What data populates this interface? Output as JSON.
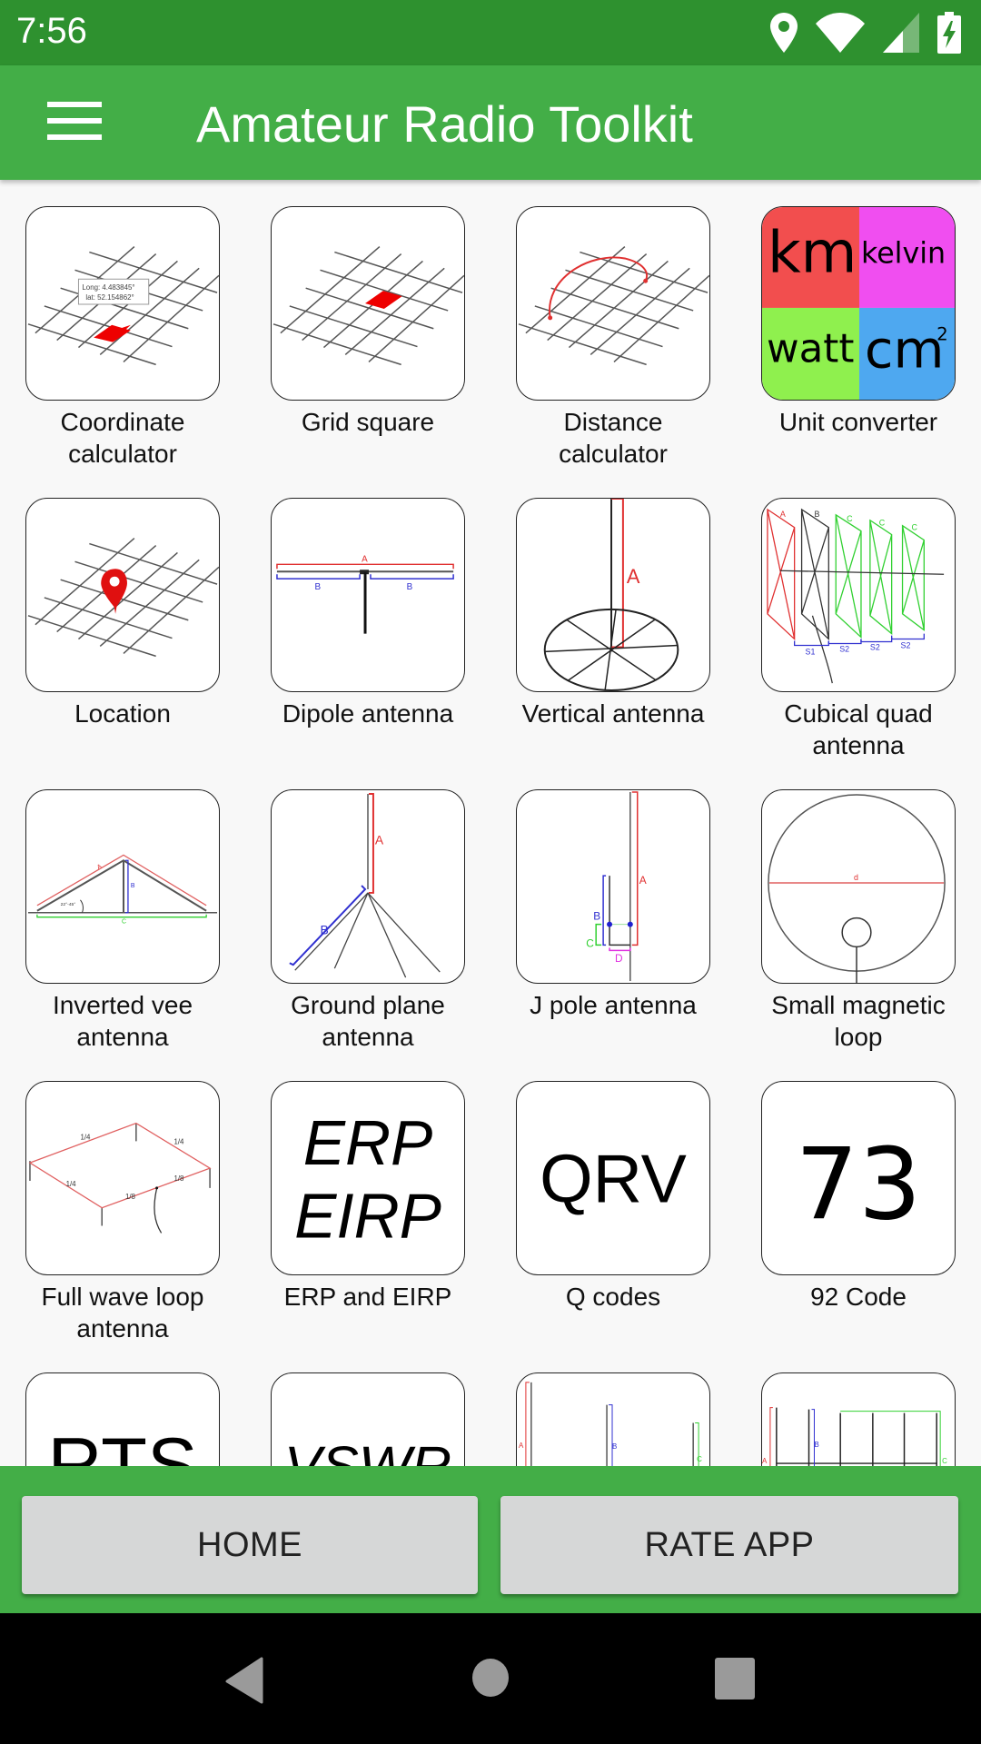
{
  "status_bar": {
    "time": "7:56",
    "icons": [
      "location-icon",
      "wifi-icon",
      "cell-signal-icon",
      "battery-charging-icon"
    ]
  },
  "app_bar": {
    "menu_icon": "hamburger-menu-icon",
    "title": "Amateur Radio Toolkit"
  },
  "tools": [
    {
      "label": "Coordinate calculator",
      "icon": "coordinate-grid-icon",
      "icon_text": [
        "Long:   4.483845°",
        "lat:  52.154862°"
      ]
    },
    {
      "label": "Grid square",
      "icon": "grid-square-icon"
    },
    {
      "label": "Distance calculator",
      "icon": "distance-arc-icon"
    },
    {
      "label": "Unit converter",
      "icon": "unit-converter-icon",
      "icon_text": [
        "km",
        "kelvin",
        "watt",
        "cm",
        "2"
      ]
    },
    {
      "label": "Location",
      "icon": "location-pin-icon"
    },
    {
      "label": "Dipole antenna",
      "icon": "dipole-antenna-icon",
      "icon_text": [
        "A",
        "B",
        "B"
      ]
    },
    {
      "label": "Vertical antenna",
      "icon": "vertical-antenna-icon",
      "icon_text": [
        "A"
      ]
    },
    {
      "label": "Cubical quad antenna",
      "icon": "cubical-quad-icon",
      "icon_text": [
        "A",
        "B",
        "C",
        "C",
        "C",
        "S1",
        "S2",
        "S2",
        "S2"
      ]
    },
    {
      "label": "Inverted vee antenna",
      "icon": "inverted-vee-icon",
      "icon_text": [
        "A",
        "B",
        "C",
        "22°-45°"
      ]
    },
    {
      "label": "Ground plane antenna",
      "icon": "ground-plane-icon",
      "icon_text": [
        "A",
        "B"
      ]
    },
    {
      "label": "J pole antenna",
      "icon": "j-pole-icon",
      "icon_text": [
        "A",
        "B",
        "C",
        "D"
      ]
    },
    {
      "label": "Small magnetic loop",
      "icon": "magnetic-loop-icon",
      "icon_text": [
        "d"
      ]
    },
    {
      "label": "Full wave loop antenna",
      "icon": "full-wave-loop-icon",
      "icon_text": [
        "1/4",
        "1/4",
        "1/4",
        "1/8",
        "1/8"
      ]
    },
    {
      "label": "ERP and EIRP",
      "icon": "erp-eirp-icon",
      "icon_text": [
        "ERP",
        "EIRP"
      ]
    },
    {
      "label": "Q codes",
      "icon": "q-codes-icon",
      "icon_text": [
        "QRV"
      ]
    },
    {
      "label": "92 Code",
      "icon": "code-73-icon",
      "icon_text": [
        "73"
      ]
    },
    {
      "label": "",
      "icon": "rts-icon",
      "icon_text": [
        "RTS"
      ]
    },
    {
      "label": "",
      "icon": "vswr-icon",
      "icon_text": [
        "VSWR"
      ]
    },
    {
      "label": "",
      "icon": "yagi-elements-icon",
      "icon_text": [
        "A",
        "B",
        "C"
      ]
    },
    {
      "label": "",
      "icon": "yagi-array-icon",
      "icon_text": [
        "A",
        "B",
        "C"
      ]
    }
  ],
  "bottom_buttons": {
    "home": "HOME",
    "rate_app": "RATE APP"
  },
  "nav_bar": {
    "back": "back-icon",
    "home": "home-circle-icon",
    "recents": "recents-square-icon"
  },
  "colors": {
    "status_bar": "#2e912f",
    "app_bar": "#43ae47",
    "button_bg": "#d6d7d7",
    "unit_km": "#f24e4e",
    "unit_kelvin": "#f04ef0",
    "unit_watt": "#8ff04e",
    "unit_cm2": "#4ea8f0"
  }
}
